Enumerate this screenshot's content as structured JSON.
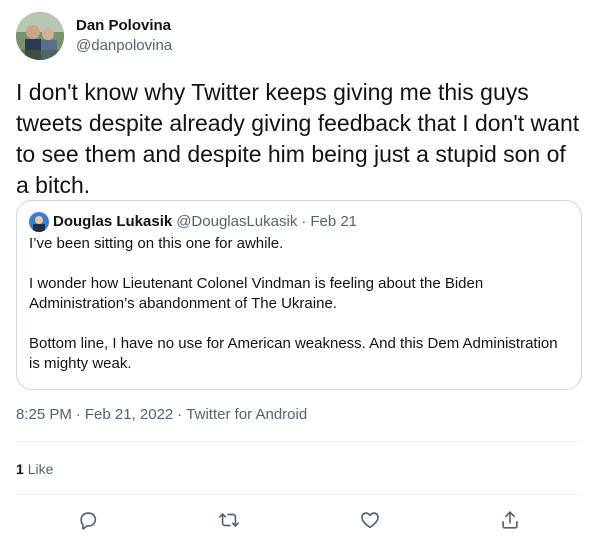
{
  "author": {
    "display_name": "Dan Polovina",
    "handle": "@danpolovina"
  },
  "tweet": {
    "text": "I don't know why Twitter keeps giving me this guys tweets despite already giving feedback that I don't want to see them and despite him being just a stupid son of a bitch."
  },
  "quote": {
    "display_name": "Douglas Lukasik",
    "handle": "@DouglasLukasik",
    "separator": "·",
    "date": "Feb 21",
    "paragraphs": [
      "I’ve been sitting on this one for awhile.",
      "I wonder how Lieutenant Colonel Vindman is feeling about the Biden Administration’s abandonment of The Ukraine.",
      "Bottom line, I have no use for American weakness.  And this Dem Administration is mighty weak."
    ]
  },
  "meta": {
    "time": "8:25 PM",
    "separator": "·",
    "date": "Feb 21, 2022",
    "source": "Twitter for Android"
  },
  "engagement": {
    "likes_count": "1",
    "likes_label": "Like"
  },
  "actions": [
    {
      "name": "reply",
      "icon": "reply-icon"
    },
    {
      "name": "retweet",
      "icon": "retweet-icon"
    },
    {
      "name": "like",
      "icon": "heart-icon"
    },
    {
      "name": "share",
      "icon": "share-icon"
    }
  ],
  "colors": {
    "text_primary": "#0f1419",
    "text_secondary": "#536471",
    "border": "#cfd9de"
  }
}
